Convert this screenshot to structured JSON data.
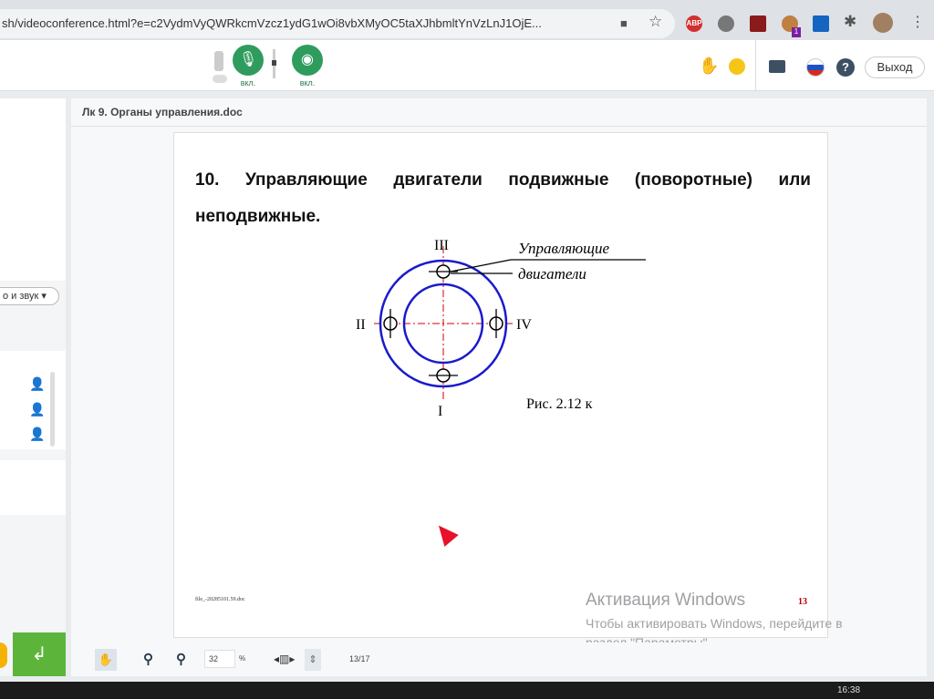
{
  "browser": {
    "url": "sh/videoconference.html?e=c2VydmVyQWRkcmVzcz1ydG1wOi8vbXMyOC5taXJhbmltYnVzLnJ1OjE...",
    "ext_badge": "1",
    "abp": "ABP"
  },
  "toolbar": {
    "mic_label": "вкл.",
    "cam_label": "вкл.",
    "exit_label": "Выход"
  },
  "sidebar": {
    "audio_select": "о и звук"
  },
  "document": {
    "title": "Лк 9. Органы управления.doc",
    "heading": "10. Управляющие двигатели подвижные (поворотные) или неподвижные.",
    "diagram": {
      "labels": [
        "III",
        "II",
        "IV",
        "I"
      ],
      "callout_line1": "Управляющие",
      "callout_line2": "двигатели",
      "caption": "Рис. 2.12 к"
    },
    "footer_file": "file_-20285101.59.doc",
    "page_number": "13"
  },
  "viewer": {
    "zoom": "32",
    "zoom_unit": "%",
    "page_counter": "13/17"
  },
  "watermark": {
    "title": "Активация Windows",
    "line1": "Чтобы активировать Windows, перейдите в",
    "line2": "раздел \"Параметры\"."
  },
  "taskbar": {
    "time": "16:38"
  },
  "colors": {
    "accent_green": "#2e9c5d",
    "send_green": "#5cb53a",
    "diagram_blue": "#1a1acc",
    "axis_red": "#d00000"
  }
}
